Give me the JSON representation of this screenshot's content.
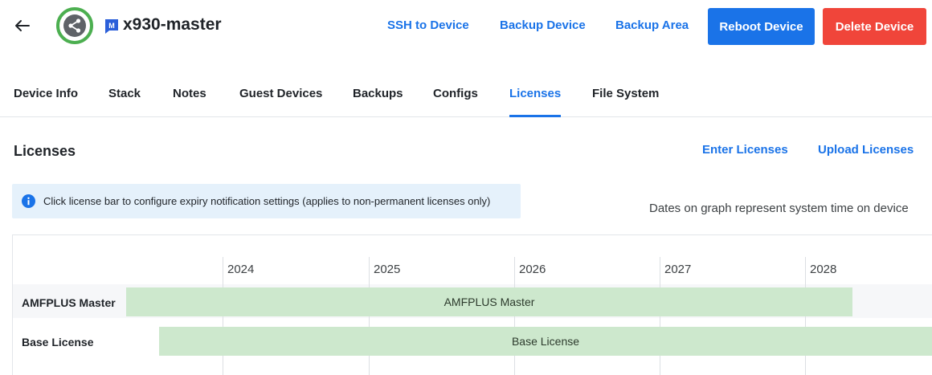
{
  "header": {
    "device_name": "x930-master",
    "model_badge": "M",
    "links": [
      "SSH to Device",
      "Backup Device",
      "Backup Area"
    ],
    "reboot_label": "Reboot Device",
    "delete_label": "Delete Device",
    "colors": {
      "primary": "#1a73e8",
      "danger": "#f0453a",
      "online": "#4caf50"
    }
  },
  "tabs": [
    {
      "label": "Device Info",
      "active": false
    },
    {
      "label": "Stack",
      "active": false
    },
    {
      "label": "Notes",
      "active": false
    },
    {
      "label": "Guest Devices",
      "active": false
    },
    {
      "label": "Backups",
      "active": false
    },
    {
      "label": "Configs",
      "active": false
    },
    {
      "label": "Licenses",
      "active": true
    },
    {
      "label": "File System",
      "active": false
    }
  ],
  "licenses": {
    "title": "Licenses",
    "enter_label": "Enter Licenses",
    "upload_label": "Upload Licenses",
    "info_text": "Click license bar to configure expiry notification settings (applies to non-permanent licenses only)",
    "dates_note": "Dates on graph represent system time on device"
  },
  "timeline": {
    "years": [
      "2024",
      "2025",
      "2026",
      "2027",
      "2028"
    ],
    "rows": [
      {
        "label": "AMFPLUS Master",
        "bar_label": "AMFPLUS Master",
        "color": "#cde8cd"
      },
      {
        "label": "Base License",
        "bar_label": "Base License",
        "color": "#cde8cd"
      }
    ]
  }
}
